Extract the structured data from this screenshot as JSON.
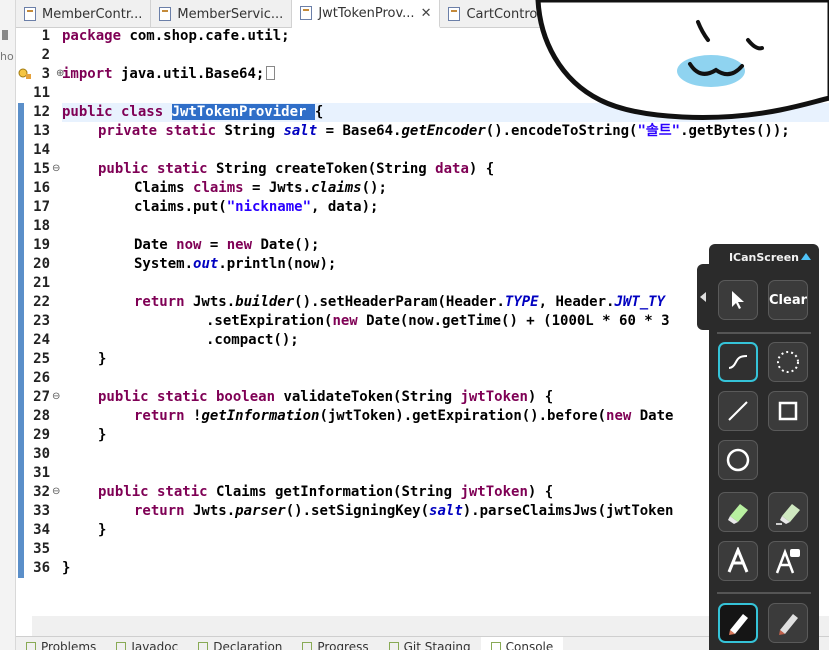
{
  "tabs": [
    {
      "label": "MemberContr...",
      "active": false
    },
    {
      "label": "MemberServic...",
      "active": false
    },
    {
      "label": "JwtTokenProv...",
      "active": true
    },
    {
      "label": "CartControll...",
      "active": false
    }
  ],
  "left_view_text": "ho",
  "editor": {
    "lines": [
      {
        "n": "1"
      },
      {
        "n": "2"
      },
      {
        "n": "3"
      },
      {
        "n": "11"
      },
      {
        "n": "12"
      },
      {
        "n": "13"
      },
      {
        "n": "14"
      },
      {
        "n": "15"
      },
      {
        "n": "16"
      },
      {
        "n": "17"
      },
      {
        "n": "18"
      },
      {
        "n": "19"
      },
      {
        "n": "20"
      },
      {
        "n": "21"
      },
      {
        "n": "22"
      },
      {
        "n": "23"
      },
      {
        "n": "24"
      },
      {
        "n": "25"
      },
      {
        "n": "26"
      },
      {
        "n": "27"
      },
      {
        "n": "28"
      },
      {
        "n": "29"
      },
      {
        "n": "30"
      },
      {
        "n": "31"
      },
      {
        "n": "32"
      },
      {
        "n": "33"
      },
      {
        "n": "34"
      },
      {
        "n": "35"
      },
      {
        "n": "36"
      }
    ],
    "code": {
      "l1_kw": "package",
      "l1_rest": " com.shop.cafe.util;",
      "l3_kw": "import",
      "l3_rest": " java.util.Base64;",
      "l12_kw": "public class",
      "l12_sel": "JwtTokenProvider ",
      "l12_rest": "{",
      "l13_kw": "private static",
      "l13_a": " String ",
      "l13_fld": "salt",
      "l13_b": " = Base64.",
      "l13_it": "getEncoder",
      "l13_c": "().encodeToString(",
      "l13_str": "\"솔트\"",
      "l13_d": ".getBytes());",
      "l15_kw": "public static",
      "l15_a": " String createToken(String ",
      "l15_p": "data",
      "l15_b": ") {",
      "l16_a": "Claims ",
      "l16_v": "claims",
      "l16_b": " = Jwts.",
      "l16_it": "claims",
      "l16_c": "();",
      "l17_a": "claims.put(",
      "l17_str": "\"nickname\"",
      "l17_b": ", data);",
      "l19_a": "Date ",
      "l19_v": "now",
      "l19_b": " = ",
      "l19_kw": "new",
      "l19_c": " Date();",
      "l20_a": "System.",
      "l20_fld": "out",
      "l20_b": ".println(now);",
      "l22_kw": "return",
      "l22_a": " Jwts.",
      "l22_it": "builder",
      "l22_b": "().setHeaderParam(Header.",
      "l22_fld": "TYPE",
      "l22_c": ", Header.",
      "l22_fld2": "JWT_TY",
      "l22_d": "",
      "l23_a": ".setExpiration(",
      "l23_kw": "new",
      "l23_b": " Date(now.getTime() + (1000L * 60 * 3",
      "l24_a": ".compact();",
      "l25_a": "}",
      "l27_kw": "public static boolean",
      "l27_a": " validateToken(String ",
      "l27_p": "jwtToken",
      "l27_b": ") {",
      "l28_kw": "return",
      "l28_a": " !",
      "l28_it": "getInformation",
      "l28_b": "(jwtToken).getExpiration().before(",
      "l28_kw2": "new",
      "l28_c": " Date",
      "l29_a": "}",
      "l32_kw": "public static",
      "l32_a": " Claims getInformation(String ",
      "l32_p": "jwtToken",
      "l32_b": ") {",
      "l33_kw": "return",
      "l33_a": " Jwts.",
      "l33_it": "parser",
      "l33_b": "().setSigningKey(",
      "l33_fld": "salt",
      "l33_c": ").parseClaimsJws(jwtToken",
      "l34_a": "}",
      "l36_a": "}"
    }
  },
  "bottom_tabs": [
    "Problems",
    "Javadoc",
    "Declaration",
    "Progress",
    "Git Staging",
    "Console"
  ],
  "icanscreen": {
    "title": "ICanScreen",
    "clear_label": "Clear",
    "accent": "#35c3d8"
  }
}
